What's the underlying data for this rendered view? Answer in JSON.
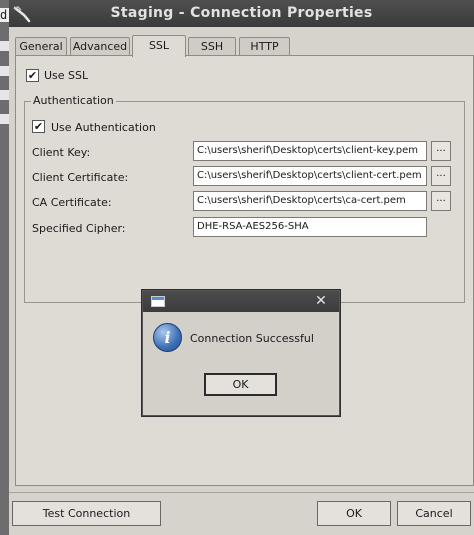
{
  "window": {
    "title": "Staging - Connection Properties"
  },
  "tabs": [
    {
      "label": "General"
    },
    {
      "label": "Advanced"
    },
    {
      "label": "SSL"
    },
    {
      "label": "SSH"
    },
    {
      "label": "HTTP"
    }
  ],
  "ssl": {
    "use_ssl_label": "Use SSL",
    "use_ssl_checked": "✔",
    "auth_group_title": "Authentication",
    "use_auth_label": "Use Authentication",
    "use_auth_checked": "✔",
    "client_key_label": "Client Key:",
    "client_key_value": "C:\\users\\sherif\\Desktop\\certs\\client-key.pem",
    "client_cert_label": "Client Certificate:",
    "client_cert_value": "C:\\users\\sherif\\Desktop\\certs\\client-cert.pem",
    "ca_cert_label": "CA Certificate:",
    "ca_cert_value": "C:\\users\\sherif\\Desktop\\certs\\ca-cert.pem",
    "cipher_label": "Specified Cipher:",
    "cipher_value": "DHE-RSA-AES256-SHA",
    "browse_label": "..."
  },
  "footer": {
    "test_connection_label": "Test Connection",
    "ok_label": "OK",
    "cancel_label": "Cancel"
  },
  "dialog": {
    "close_glyph": "✕",
    "info_glyph": "i",
    "message": "Connection Successful",
    "ok_label": "OK"
  },
  "strip": {
    "glyph": "d"
  }
}
